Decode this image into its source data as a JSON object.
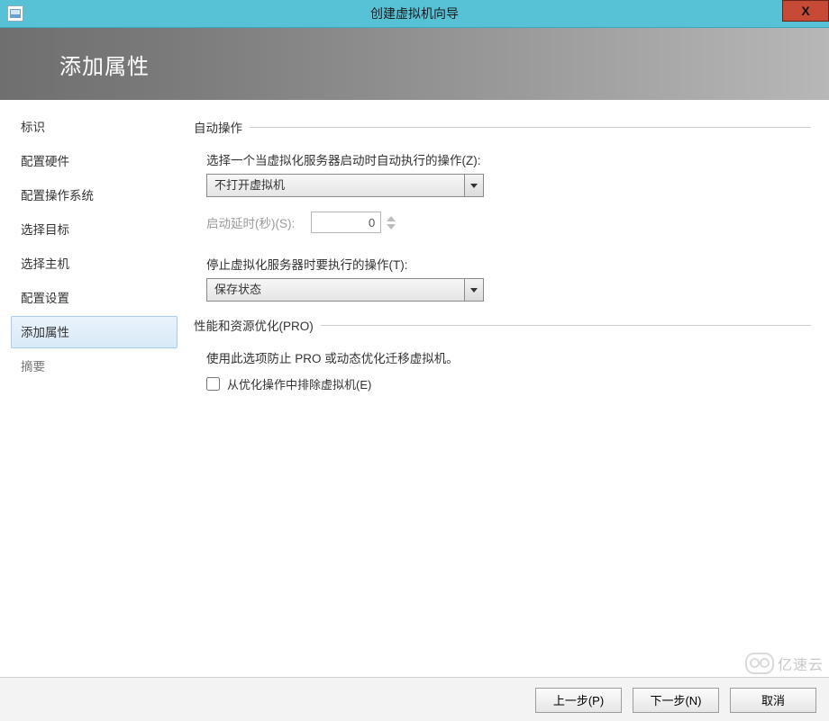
{
  "window": {
    "title": "创建虚拟机向导",
    "close_symbol": "X"
  },
  "header": {
    "title": "添加属性"
  },
  "sidebar": {
    "items": [
      {
        "label": "标识"
      },
      {
        "label": "配置硬件"
      },
      {
        "label": "配置操作系统"
      },
      {
        "label": "选择目标"
      },
      {
        "label": "选择主机"
      },
      {
        "label": "配置设置"
      },
      {
        "label": "添加属性",
        "selected": true
      },
      {
        "label": "摘要",
        "muted": true
      }
    ]
  },
  "content": {
    "auto_ops_group": "自动操作",
    "start_action_label": "选择一个当虚拟化服务器启动时自动执行的操作(Z):",
    "start_action_value": "不打开虚拟机",
    "delay_label": "启动延时(秒)(S):",
    "delay_value": "0",
    "stop_action_label": "停止虚拟化服务器时要执行的操作(T):",
    "stop_action_value": "保存状态",
    "pro_group": "性能和资源优化(PRO)",
    "pro_desc": "使用此选项防止 PRO 或动态优化迁移虚拟机。",
    "exclude_checkbox_label": "从优化操作中排除虚拟机(E)",
    "exclude_checked": false
  },
  "footer": {
    "prev": "上一步(P)",
    "next": "下一步(N)",
    "cancel": "取消"
  },
  "watermark": {
    "text": "亿速云"
  }
}
